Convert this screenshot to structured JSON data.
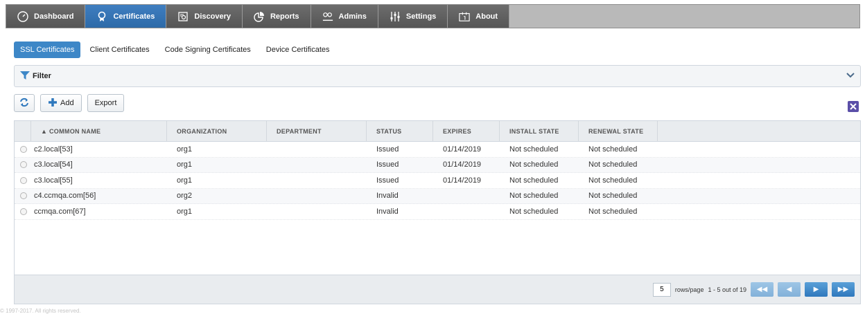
{
  "nav": {
    "items": [
      {
        "label": "Dashboard",
        "icon": "dashboard-icon"
      },
      {
        "label": "Certificates",
        "icon": "certificate-icon"
      },
      {
        "label": "Discovery",
        "icon": "discovery-icon"
      },
      {
        "label": "Reports",
        "icon": "reports-icon"
      },
      {
        "label": "Admins",
        "icon": "admins-icon"
      },
      {
        "label": "Settings",
        "icon": "settings-icon"
      },
      {
        "label": "About",
        "icon": "about-icon"
      }
    ],
    "active_index": 1
  },
  "subtabs": [
    "SSL Certificates",
    "Client Certificates",
    "Code Signing Certificates",
    "Device Certificates"
  ],
  "filter": {
    "label": "Filter"
  },
  "toolbar": {
    "add_label": "Add",
    "export_label": "Export"
  },
  "table": {
    "columns": [
      "▲ COMMON NAME",
      "ORGANIZATION",
      "DEPARTMENT",
      "STATUS",
      "EXPIRES",
      "INSTALL STATE",
      "RENEWAL STATE"
    ],
    "rows": [
      {
        "name": "c2.local[53]",
        "org": "org1",
        "dept": "",
        "status": "Issued",
        "expires": "01/14/2019",
        "install": "Not scheduled",
        "renewal": "Not scheduled"
      },
      {
        "name": "c3.local[54]",
        "org": "org1",
        "dept": "",
        "status": "Issued",
        "expires": "01/14/2019",
        "install": "Not scheduled",
        "renewal": "Not scheduled"
      },
      {
        "name": "c3.local[55]",
        "org": "org1",
        "dept": "",
        "status": "Issued",
        "expires": "01/14/2019",
        "install": "Not scheduled",
        "renewal": "Not scheduled"
      },
      {
        "name": "c4.ccmqa.com[56]",
        "org": "org2",
        "dept": "",
        "status": "Invalid",
        "expires": "",
        "install": "Not scheduled",
        "renewal": "Not scheduled"
      },
      {
        "name": "ccmqa.com[67]",
        "org": "org1",
        "dept": "",
        "status": "Invalid",
        "expires": "",
        "install": "Not scheduled",
        "renewal": "Not scheduled"
      }
    ]
  },
  "pager": {
    "rows_per_page": "5",
    "rows_label": "rows/page",
    "range": "1 - 5 out of 19"
  },
  "footer": {
    "text": "© 1997-2017. All rights reserved."
  },
  "colors": {
    "accent": "#3d87c7",
    "nav_bg": "#555555"
  }
}
